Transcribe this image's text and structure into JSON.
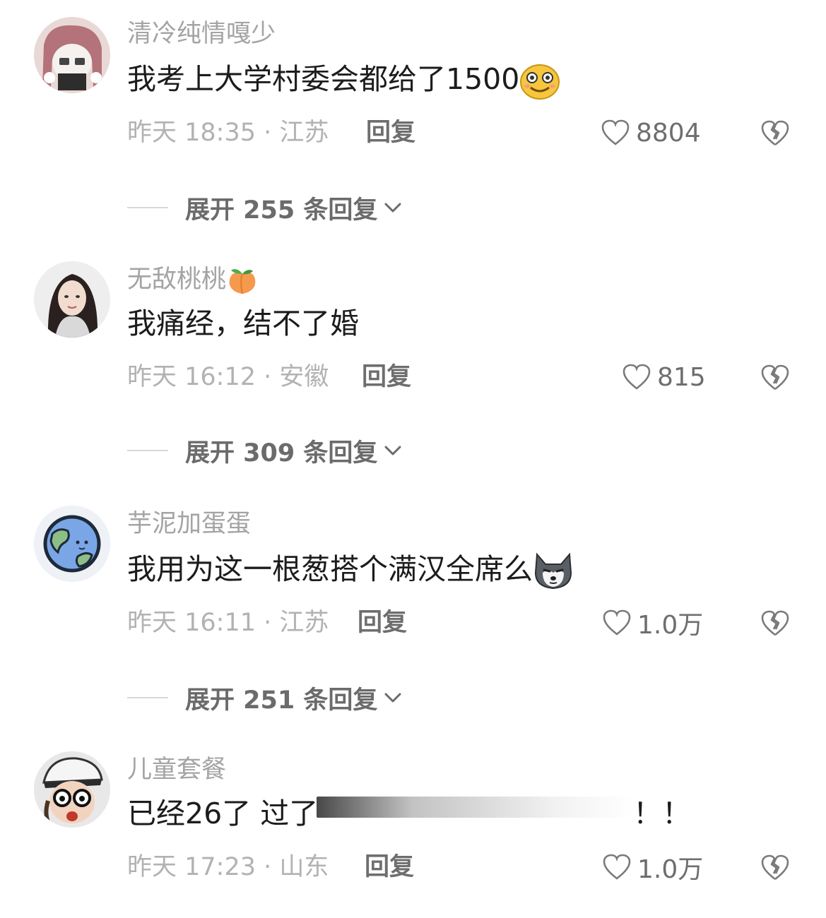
{
  "comments": [
    {
      "username": "清冷纯情嘎少",
      "text": "我考上大学村委会都给了1500",
      "time_location": "昨天 18:35 · 江苏",
      "reply_label": "回复",
      "likes": "8804",
      "expand_label": "展开 255 条回复",
      "avatar_icon": "anime-avatar",
      "trailing_emoji": "smiley-emoji"
    },
    {
      "username": "无敌桃桃",
      "text": "我痛经，结不了婚",
      "time_location": "昨天 16:12 · 安徽",
      "reply_label": "回复",
      "likes": "815",
      "expand_label": "展开 309 条回复",
      "avatar_icon": "photo-avatar",
      "name_emoji": "peach-emoji"
    },
    {
      "username": "芋泥加蛋蛋",
      "text": "我用为这一根葱搭个满汉全席么",
      "time_location": "昨天 16:11 · 江苏",
      "reply_label": "回复",
      "likes": "1.0万",
      "expand_label": "展开 251 条回复",
      "avatar_icon": "earth-avatar",
      "trailing_emoji": "husky-emoji"
    },
    {
      "username": "儿童套餐",
      "text_before": "已经26了 过了",
      "text_after": "！！",
      "time_location": "昨天 17:23 · 山东",
      "reply_label": "回复",
      "likes": "1.0万",
      "avatar_icon": "glasses-avatar"
    }
  ],
  "colors": {
    "username": "#a4a4a4",
    "text": "#1c1c1c",
    "meta": "#b2b2b2",
    "reply": "#6e6e6e"
  }
}
